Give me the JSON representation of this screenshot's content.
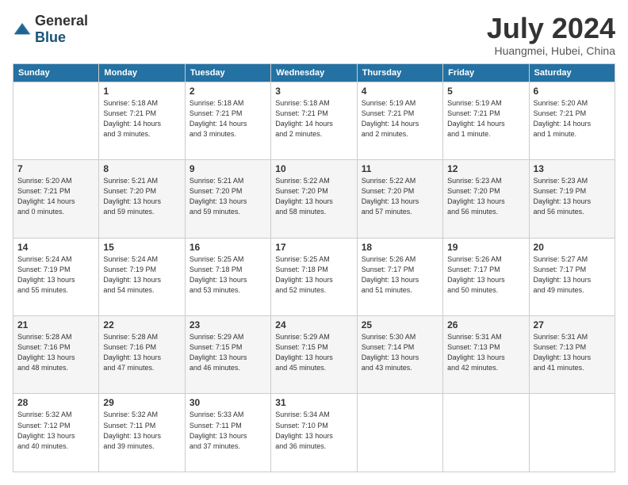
{
  "header": {
    "logo_general": "General",
    "logo_blue": "Blue",
    "month_title": "July 2024",
    "subtitle": "Huangmei, Hubei, China"
  },
  "days_of_week": [
    "Sunday",
    "Monday",
    "Tuesday",
    "Wednesday",
    "Thursday",
    "Friday",
    "Saturday"
  ],
  "weeks": [
    [
      {
        "day": "",
        "info": ""
      },
      {
        "day": "1",
        "info": "Sunrise: 5:18 AM\nSunset: 7:21 PM\nDaylight: 14 hours\nand 3 minutes."
      },
      {
        "day": "2",
        "info": "Sunrise: 5:18 AM\nSunset: 7:21 PM\nDaylight: 14 hours\nand 3 minutes."
      },
      {
        "day": "3",
        "info": "Sunrise: 5:18 AM\nSunset: 7:21 PM\nDaylight: 14 hours\nand 2 minutes."
      },
      {
        "day": "4",
        "info": "Sunrise: 5:19 AM\nSunset: 7:21 PM\nDaylight: 14 hours\nand 2 minutes."
      },
      {
        "day": "5",
        "info": "Sunrise: 5:19 AM\nSunset: 7:21 PM\nDaylight: 14 hours\nand 1 minute."
      },
      {
        "day": "6",
        "info": "Sunrise: 5:20 AM\nSunset: 7:21 PM\nDaylight: 14 hours\nand 1 minute."
      }
    ],
    [
      {
        "day": "7",
        "info": "Sunrise: 5:20 AM\nSunset: 7:21 PM\nDaylight: 14 hours\nand 0 minutes."
      },
      {
        "day": "8",
        "info": "Sunrise: 5:21 AM\nSunset: 7:20 PM\nDaylight: 13 hours\nand 59 minutes."
      },
      {
        "day": "9",
        "info": "Sunrise: 5:21 AM\nSunset: 7:20 PM\nDaylight: 13 hours\nand 59 minutes."
      },
      {
        "day": "10",
        "info": "Sunrise: 5:22 AM\nSunset: 7:20 PM\nDaylight: 13 hours\nand 58 minutes."
      },
      {
        "day": "11",
        "info": "Sunrise: 5:22 AM\nSunset: 7:20 PM\nDaylight: 13 hours\nand 57 minutes."
      },
      {
        "day": "12",
        "info": "Sunrise: 5:23 AM\nSunset: 7:20 PM\nDaylight: 13 hours\nand 56 minutes."
      },
      {
        "day": "13",
        "info": "Sunrise: 5:23 AM\nSunset: 7:19 PM\nDaylight: 13 hours\nand 56 minutes."
      }
    ],
    [
      {
        "day": "14",
        "info": "Sunrise: 5:24 AM\nSunset: 7:19 PM\nDaylight: 13 hours\nand 55 minutes."
      },
      {
        "day": "15",
        "info": "Sunrise: 5:24 AM\nSunset: 7:19 PM\nDaylight: 13 hours\nand 54 minutes."
      },
      {
        "day": "16",
        "info": "Sunrise: 5:25 AM\nSunset: 7:18 PM\nDaylight: 13 hours\nand 53 minutes."
      },
      {
        "day": "17",
        "info": "Sunrise: 5:25 AM\nSunset: 7:18 PM\nDaylight: 13 hours\nand 52 minutes."
      },
      {
        "day": "18",
        "info": "Sunrise: 5:26 AM\nSunset: 7:17 PM\nDaylight: 13 hours\nand 51 minutes."
      },
      {
        "day": "19",
        "info": "Sunrise: 5:26 AM\nSunset: 7:17 PM\nDaylight: 13 hours\nand 50 minutes."
      },
      {
        "day": "20",
        "info": "Sunrise: 5:27 AM\nSunset: 7:17 PM\nDaylight: 13 hours\nand 49 minutes."
      }
    ],
    [
      {
        "day": "21",
        "info": "Sunrise: 5:28 AM\nSunset: 7:16 PM\nDaylight: 13 hours\nand 48 minutes."
      },
      {
        "day": "22",
        "info": "Sunrise: 5:28 AM\nSunset: 7:16 PM\nDaylight: 13 hours\nand 47 minutes."
      },
      {
        "day": "23",
        "info": "Sunrise: 5:29 AM\nSunset: 7:15 PM\nDaylight: 13 hours\nand 46 minutes."
      },
      {
        "day": "24",
        "info": "Sunrise: 5:29 AM\nSunset: 7:15 PM\nDaylight: 13 hours\nand 45 minutes."
      },
      {
        "day": "25",
        "info": "Sunrise: 5:30 AM\nSunset: 7:14 PM\nDaylight: 13 hours\nand 43 minutes."
      },
      {
        "day": "26",
        "info": "Sunrise: 5:31 AM\nSunset: 7:13 PM\nDaylight: 13 hours\nand 42 minutes."
      },
      {
        "day": "27",
        "info": "Sunrise: 5:31 AM\nSunset: 7:13 PM\nDaylight: 13 hours\nand 41 minutes."
      }
    ],
    [
      {
        "day": "28",
        "info": "Sunrise: 5:32 AM\nSunset: 7:12 PM\nDaylight: 13 hours\nand 40 minutes."
      },
      {
        "day": "29",
        "info": "Sunrise: 5:32 AM\nSunset: 7:11 PM\nDaylight: 13 hours\nand 39 minutes."
      },
      {
        "day": "30",
        "info": "Sunrise: 5:33 AM\nSunset: 7:11 PM\nDaylight: 13 hours\nand 37 minutes."
      },
      {
        "day": "31",
        "info": "Sunrise: 5:34 AM\nSunset: 7:10 PM\nDaylight: 13 hours\nand 36 minutes."
      },
      {
        "day": "",
        "info": ""
      },
      {
        "day": "",
        "info": ""
      },
      {
        "day": "",
        "info": ""
      }
    ]
  ]
}
